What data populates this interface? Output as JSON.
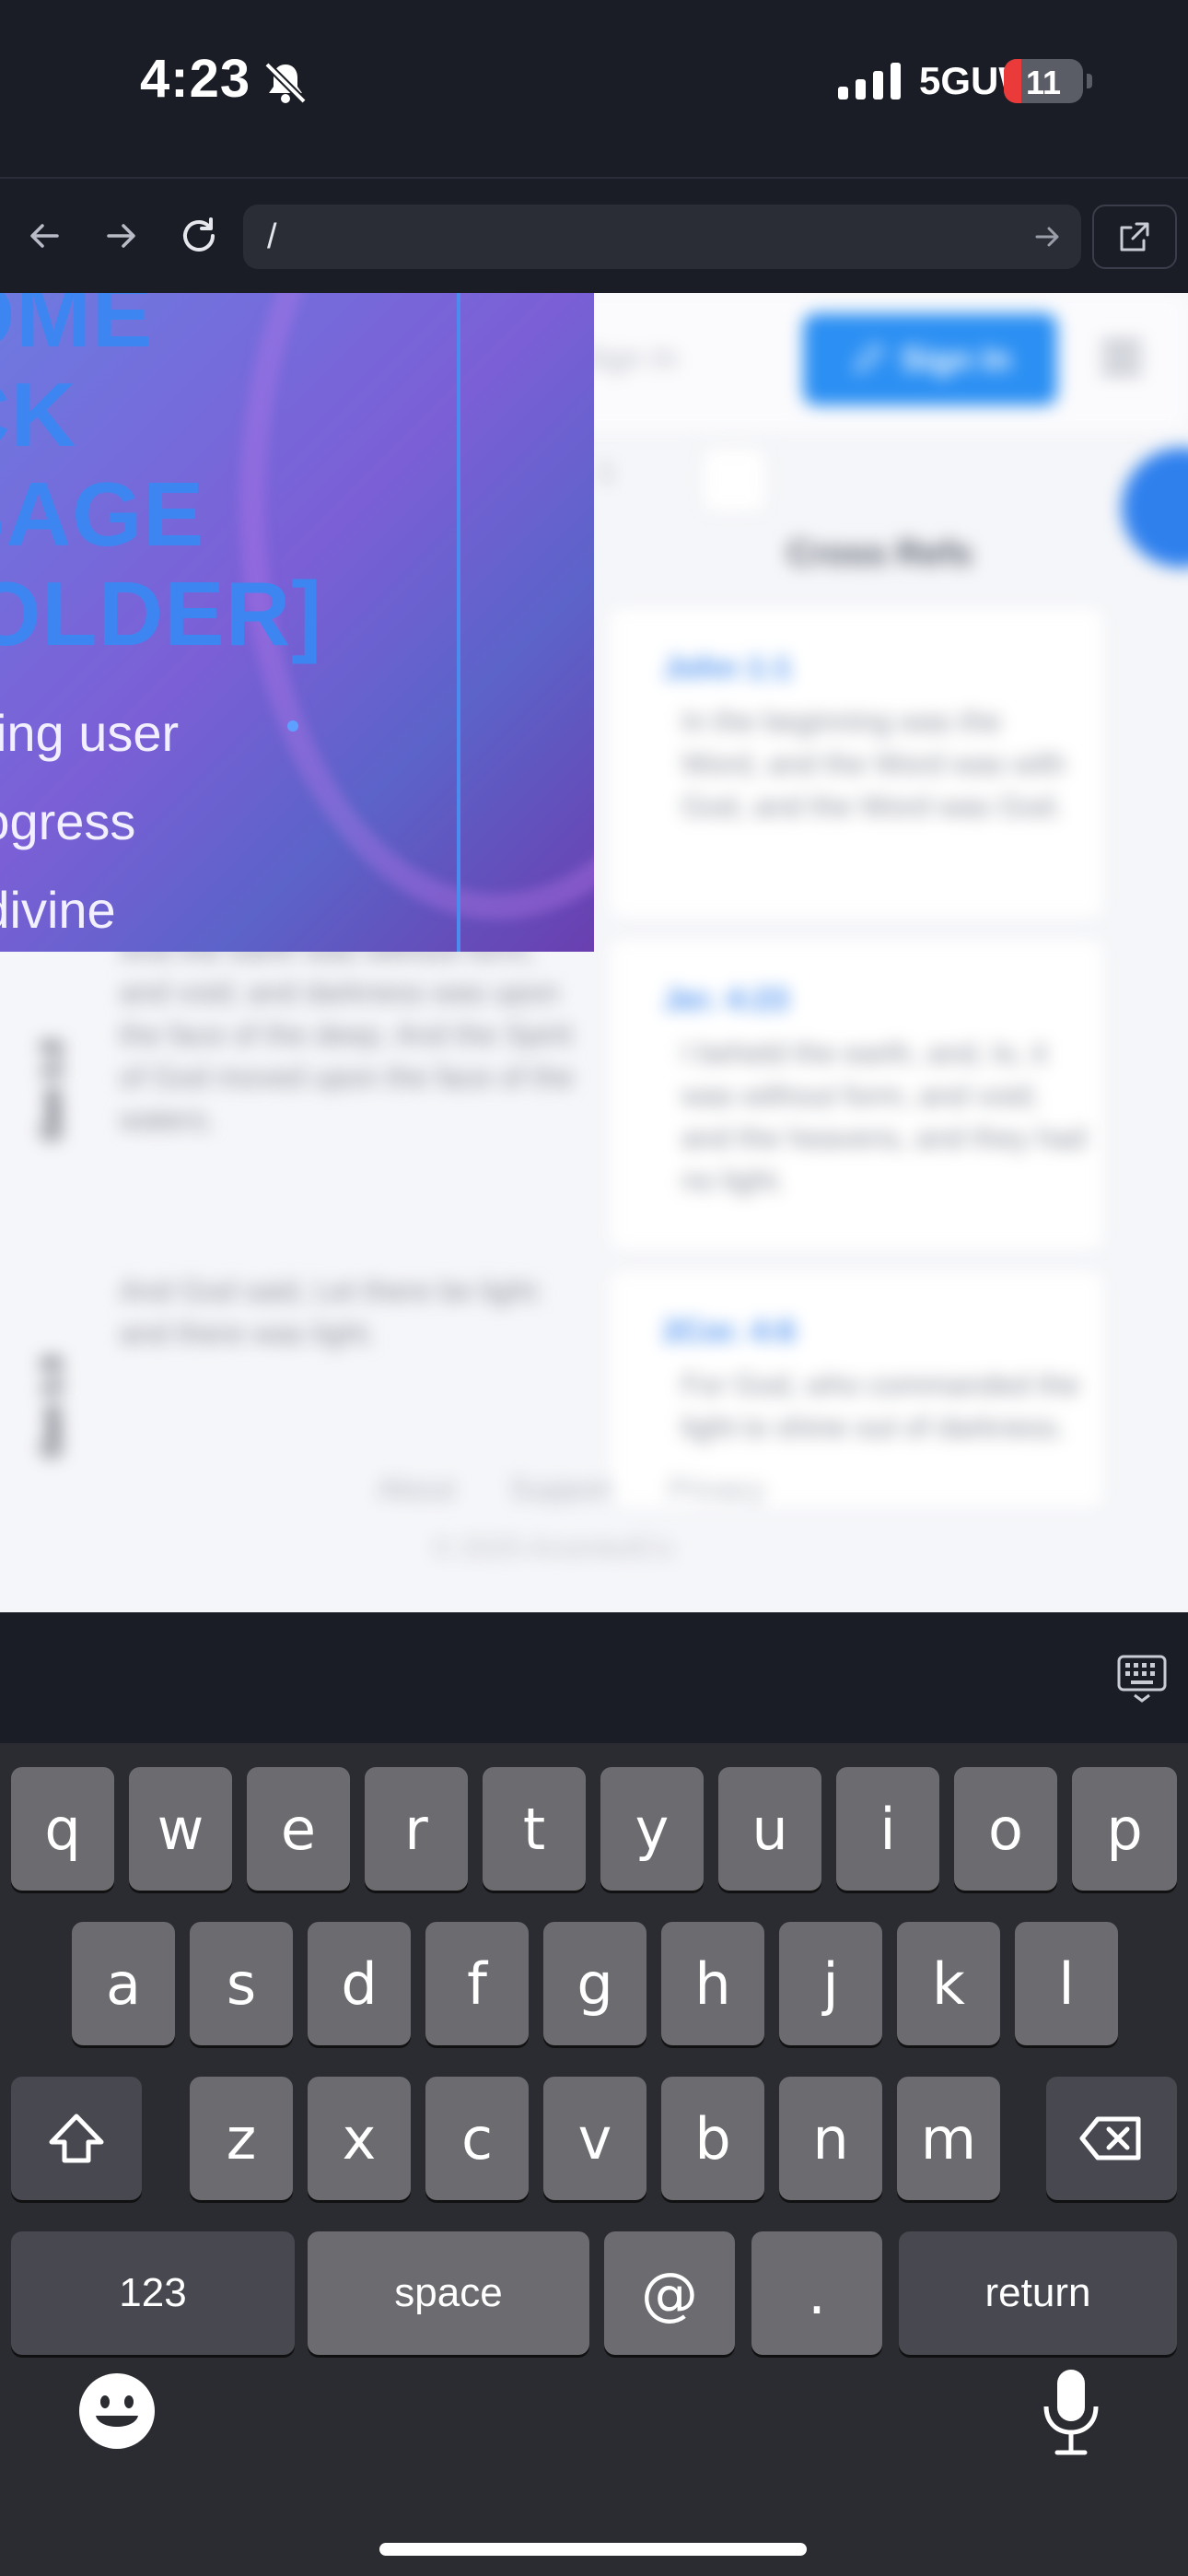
{
  "status_bar": {
    "time": "4:23",
    "network": "5GUW",
    "battery_level": "11",
    "icons": [
      "bell-slash-icon",
      "signal-bars-icon",
      "battery-icon"
    ]
  },
  "browser": {
    "url": "/",
    "icons": [
      "back-arrow-icon",
      "forward-arrow-icon",
      "reload-icon",
      "go-arrow-icon",
      "open-external-icon"
    ]
  },
  "page": {
    "header_link": "Sign In",
    "signin_button": "Sign In",
    "column_header": "Cross Refs",
    "promo": {
      "title": "OME\nCK\nSAGE\nIOLDER]",
      "body": "urning user\n progress\nor divine"
    },
    "rows": [
      {
        "label": "",
        "left_verse": "",
        "ref": "John 1:1",
        "ref_verse": "In the beginning was the Word, and the Word was with God, and the Word was God."
      },
      {
        "label": "Gen 1:2",
        "left_verse": "And the earth was without form, and void; and darkness was upon the face of the deep. And the Spirit of God moved upon the face of the waters.",
        "ref": "Jer. 4:23",
        "ref_verse": "I beheld the earth, and, lo, it was without form, and void; and the heavens, and they had no light."
      },
      {
        "label": "Gen 1:3",
        "left_verse": "And God said, Let there be light: and there was light.",
        "ref": "2Cor. 4:6",
        "ref_verse": "For God, who commanded the light to shine out of darkness."
      }
    ],
    "footer_links": [
      "About",
      "Support",
      "Privacy"
    ],
    "copyright": "© 2025 AnointedCo"
  },
  "keyboard": {
    "row1": [
      "q",
      "w",
      "e",
      "r",
      "t",
      "y",
      "u",
      "i",
      "o",
      "p"
    ],
    "row2": [
      "a",
      "s",
      "d",
      "f",
      "g",
      "h",
      "j",
      "k",
      "l"
    ],
    "row3": [
      "z",
      "x",
      "c",
      "v",
      "b",
      "n",
      "m"
    ],
    "numbers_key": "123",
    "space_key": "space",
    "at_key": "@",
    "period_key": ".",
    "return_key": "return",
    "icons": [
      "shift-icon",
      "backspace-icon",
      "emoji-icon",
      "microphone-icon",
      "keyboard-dismiss-icon"
    ]
  },
  "colors": {
    "accent": "#2b8ff3",
    "battery_low": "#ea3a3a",
    "keyboard_bg": "#2b2c31",
    "key_bg": "#6b6b70"
  }
}
